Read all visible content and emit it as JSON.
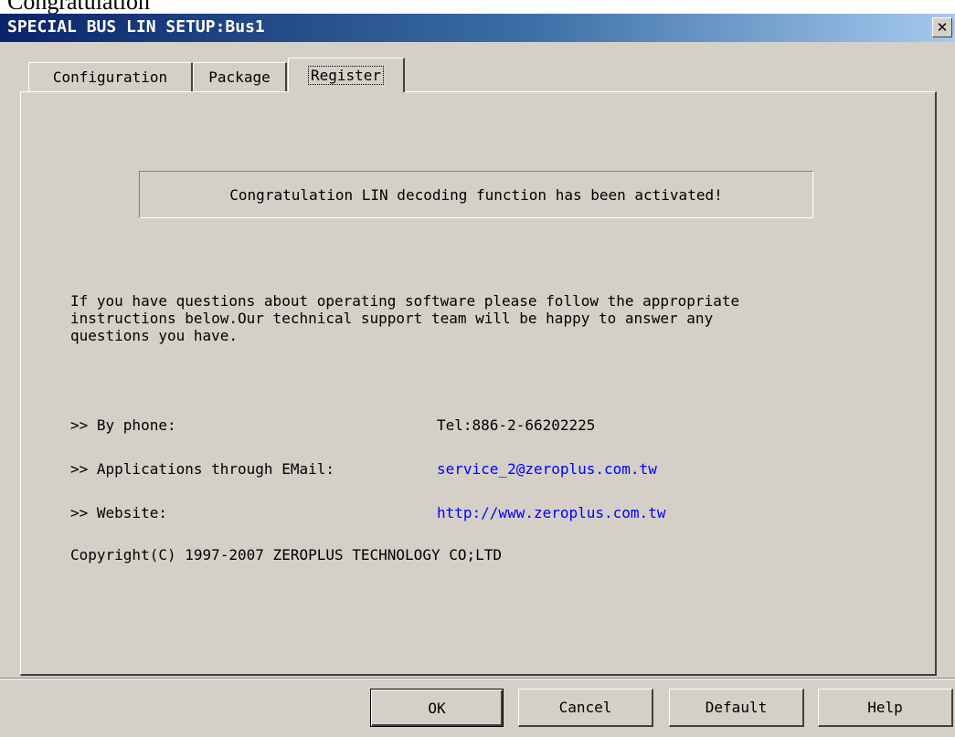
{
  "top_fragment": "Congratulation",
  "window": {
    "title": "SPECIAL BUS LIN SETUP:Bus1",
    "close_glyph": "✕"
  },
  "tabs": [
    {
      "label": "Configuration",
      "active": false
    },
    {
      "label": "Package",
      "active": false
    },
    {
      "label": "Register",
      "active": true
    }
  ],
  "register": {
    "message": "Congratulation LIN decoding function has been activated!",
    "info_lines": [
      "If you have questions about operating software please follow the appropriate",
      "instructions below.Our technical support team will be happy to answer any",
      "questions you have."
    ],
    "contacts": [
      {
        "label": ">> By phone:",
        "value": "Tel:886-2-66202225",
        "is_link": false
      },
      {
        "label": ">> Applications through EMail:",
        "value": "service_2@zeroplus.com.tw",
        "is_link": true
      },
      {
        "label": ">> Website:",
        "value": "http://www.zeroplus.com.tw",
        "is_link": true
      }
    ],
    "copyright": "Copyright(C) 1997-2007 ZEROPLUS TECHNOLOGY CO;LTD"
  },
  "buttons": {
    "ok": "OK",
    "cancel": "Cancel",
    "default": "Default",
    "help": "Help"
  },
  "colors": {
    "title_start": "#0a246a",
    "title_end": "#a6caf0",
    "dialog_bg": "#d4d0c8",
    "link": "#0000ff"
  }
}
